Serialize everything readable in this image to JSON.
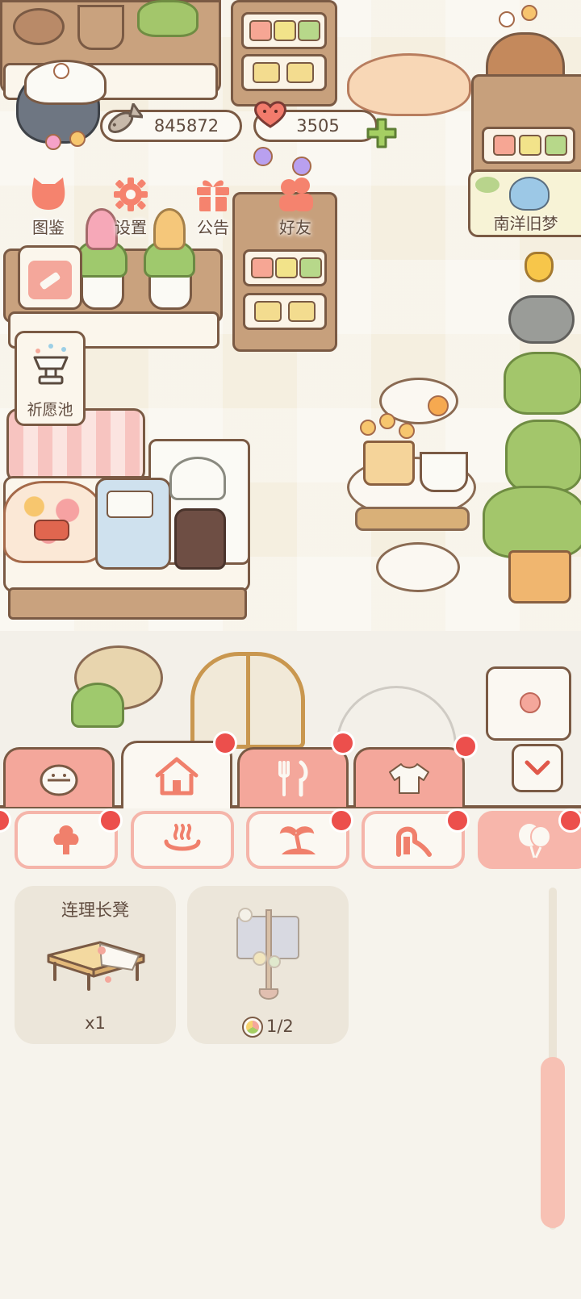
{
  "currency": {
    "fish_coins": "845872",
    "hearts": "3505"
  },
  "hud_menu": [
    {
      "label": "图鉴",
      "icon": "cat-book-icon"
    },
    {
      "label": "设置",
      "icon": "gear-icon"
    },
    {
      "label": "公告",
      "icon": "gift-icon"
    },
    {
      "label": "好友",
      "icon": "friends-icon"
    }
  ],
  "wish_pool": {
    "label": "祈愿池"
  },
  "event_banner": {
    "label": "南洋旧梦"
  },
  "category_tabs": [
    {
      "icon": "cat-face-icon",
      "active": false,
      "badge": false
    },
    {
      "icon": "house-icon",
      "active": true,
      "badge": true
    },
    {
      "icon": "fork-knife-icon",
      "active": false,
      "badge": true
    },
    {
      "icon": "shirt-icon",
      "active": false,
      "badge": true
    }
  ],
  "sub_tabs": [
    {
      "icon": "tree-icon",
      "active": false,
      "badge": true
    },
    {
      "icon": "hot-spring-icon",
      "active": false,
      "badge": false
    },
    {
      "icon": "palm-island-icon",
      "active": false,
      "badge": true
    },
    {
      "icon": "slide-icon",
      "active": false,
      "badge": true
    },
    {
      "icon": "balloon-icon",
      "active": true,
      "badge": true
    }
  ],
  "items": [
    {
      "name": "连理长凳",
      "count": "x1"
    },
    {
      "name": "",
      "count": "1/2"
    }
  ],
  "colors": {
    "tab_pink": "#f4a79b",
    "badge_red": "#ec4f4c",
    "wood_brown": "#7a5a44",
    "panel_bg": "#f3f0e9"
  }
}
